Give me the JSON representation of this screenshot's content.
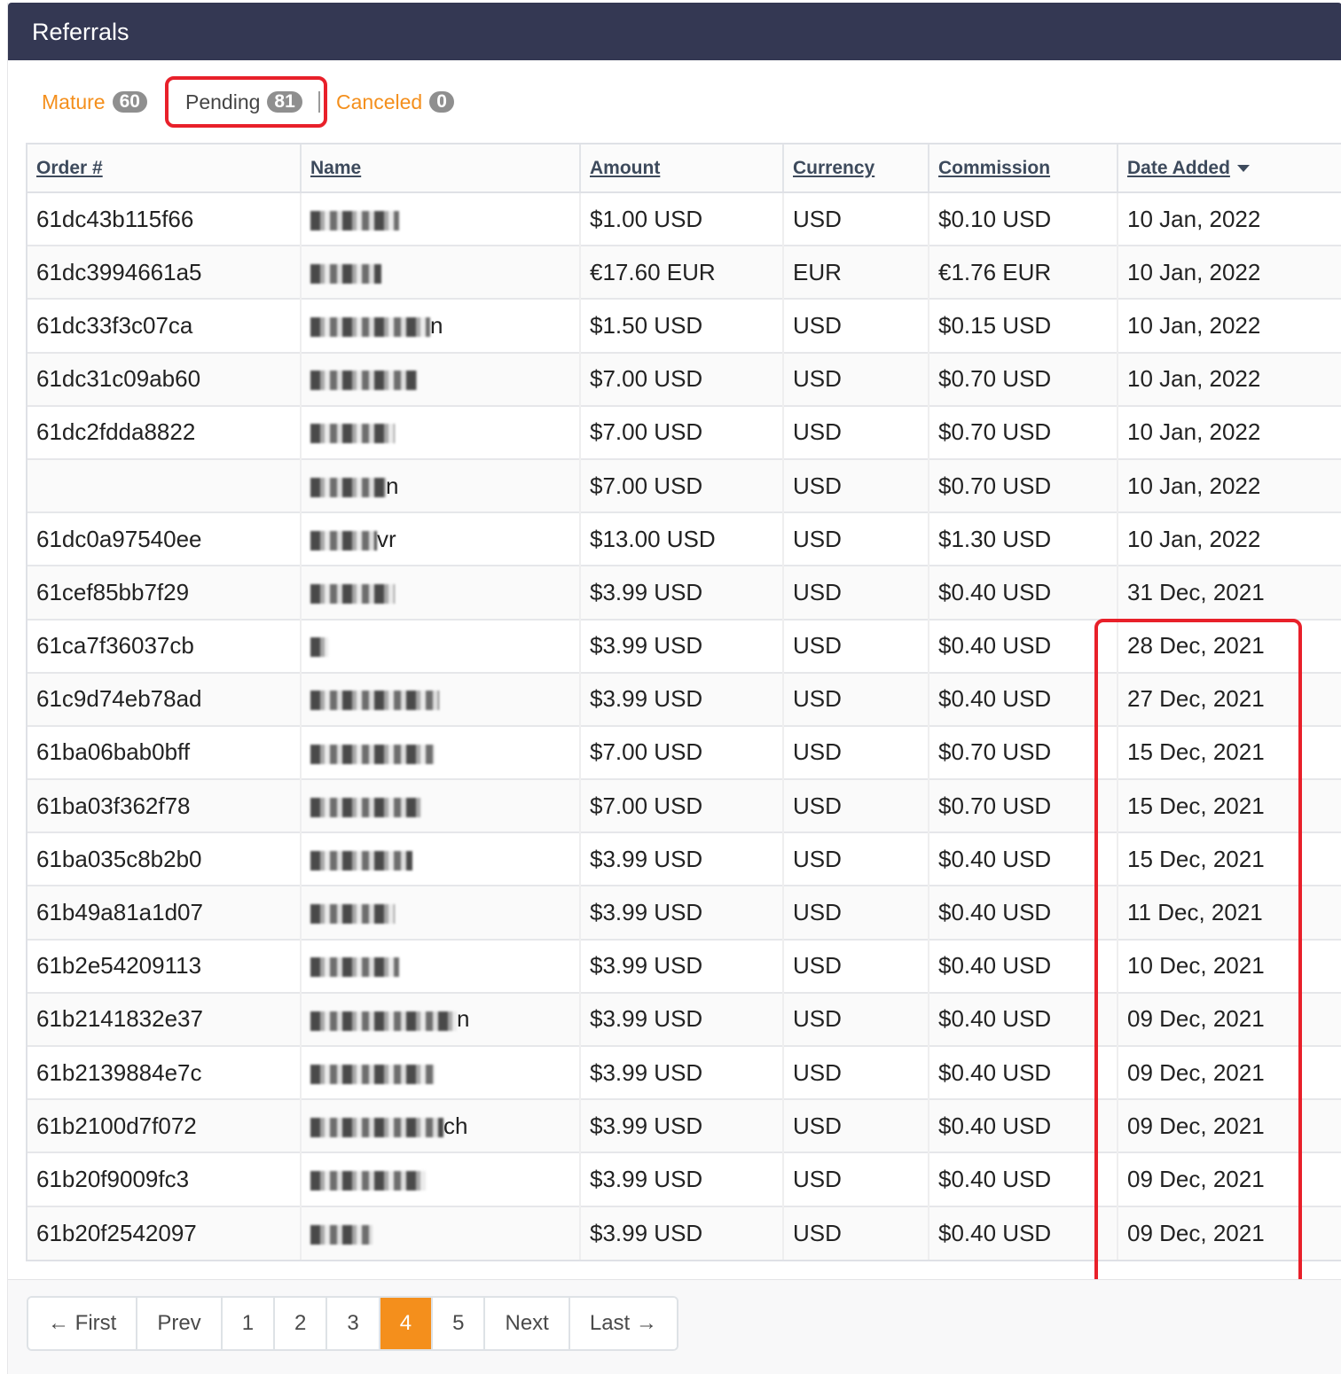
{
  "panel": {
    "title": "Referrals"
  },
  "tabs": [
    {
      "label": "Mature",
      "count": "60"
    },
    {
      "label": "Pending",
      "count": "81"
    },
    {
      "label": "Canceled",
      "count": "0"
    }
  ],
  "table": {
    "headers": [
      "Order #",
      "Name",
      "Amount",
      "Currency",
      "Commission",
      "Date Added"
    ],
    "rows": [
      {
        "order": "61dc43b115f66",
        "name_tail": "",
        "amount": "$1.00 USD",
        "currency": "USD",
        "commission": "$0.10 USD",
        "date": "10 Jan, 2022"
      },
      {
        "order": "61dc3994661a5",
        "name_tail": "",
        "amount": "€17.60 EUR",
        "currency": "EUR",
        "commission": "€1.76 EUR",
        "date": "10 Jan, 2022"
      },
      {
        "order": "61dc33f3c07ca",
        "name_tail": "n",
        "amount": "$1.50 USD",
        "currency": "USD",
        "commission": "$0.15 USD",
        "date": "10 Jan, 2022"
      },
      {
        "order": "61dc31c09ab60",
        "name_tail": "",
        "amount": "$7.00 USD",
        "currency": "USD",
        "commission": "$0.70 USD",
        "date": "10 Jan, 2022"
      },
      {
        "order": "61dc2fdda8822",
        "name_tail": "",
        "amount": "$7.00 USD",
        "currency": "USD",
        "commission": "$0.70 USD",
        "date": "10 Jan, 2022"
      },
      {
        "order": "",
        "name_tail": "n",
        "amount": "$7.00 USD",
        "currency": "USD",
        "commission": "$0.70 USD",
        "date": "10 Jan, 2022"
      },
      {
        "order": "61dc0a97540ee",
        "name_tail": "vr",
        "amount": "$13.00 USD",
        "currency": "USD",
        "commission": "$1.30 USD",
        "date": "10 Jan, 2022"
      },
      {
        "order": "61cef85bb7f29",
        "name_tail": "",
        "amount": "$3.99 USD",
        "currency": "USD",
        "commission": "$0.40 USD",
        "date": "31 Dec, 2021"
      },
      {
        "order": "61ca7f36037cb",
        "name_tail": "",
        "amount": "$3.99 USD",
        "currency": "USD",
        "commission": "$0.40 USD",
        "date": "28 Dec, 2021"
      },
      {
        "order": "61c9d74eb78ad",
        "name_tail": "",
        "amount": "$3.99 USD",
        "currency": "USD",
        "commission": "$0.40 USD",
        "date": "27 Dec, 2021"
      },
      {
        "order": "61ba06bab0bff",
        "name_tail": "",
        "amount": "$7.00 USD",
        "currency": "USD",
        "commission": "$0.70 USD",
        "date": "15 Dec, 2021"
      },
      {
        "order": "61ba03f362f78",
        "name_tail": "",
        "amount": "$7.00 USD",
        "currency": "USD",
        "commission": "$0.70 USD",
        "date": "15 Dec, 2021"
      },
      {
        "order": "61ba035c8b2b0",
        "name_tail": "",
        "amount": "$3.99 USD",
        "currency": "USD",
        "commission": "$0.40 USD",
        "date": "15 Dec, 2021"
      },
      {
        "order": "61b49a81a1d07",
        "name_tail": "",
        "amount": "$3.99 USD",
        "currency": "USD",
        "commission": "$0.40 USD",
        "date": "11 Dec, 2021"
      },
      {
        "order": "61b2e54209113",
        "name_tail": "",
        "amount": "$3.99 USD",
        "currency": "USD",
        "commission": "$0.40 USD",
        "date": "10 Dec, 2021"
      },
      {
        "order": "61b2141832e37",
        "name_tail": "n",
        "amount": "$3.99 USD",
        "currency": "USD",
        "commission": "$0.40 USD",
        "date": "09 Dec, 2021"
      },
      {
        "order": "61b2139884e7c",
        "name_tail": "",
        "amount": "$3.99 USD",
        "currency": "USD",
        "commission": "$0.40 USD",
        "date": "09 Dec, 2021"
      },
      {
        "order": "61b2100d7f072",
        "name_tail": "ch",
        "amount": "$3.99 USD",
        "currency": "USD",
        "commission": "$0.40 USD",
        "date": "09 Dec, 2021"
      },
      {
        "order": "61b20f9009fc3",
        "name_tail": "",
        "amount": "$3.99 USD",
        "currency": "USD",
        "commission": "$0.40 USD",
        "date": "09 Dec, 2021"
      },
      {
        "order": "61b20f2542097",
        "name_tail": "",
        "amount": "$3.99 USD",
        "currency": "USD",
        "commission": "$0.40 USD",
        "date": "09 Dec, 2021"
      }
    ]
  },
  "pagination": {
    "items": [
      {
        "label": "← First",
        "active": false
      },
      {
        "label": "Prev",
        "active": false
      },
      {
        "label": "1",
        "active": false
      },
      {
        "label": "2",
        "active": false
      },
      {
        "label": "3",
        "active": false
      },
      {
        "label": "4",
        "active": true
      },
      {
        "label": "5",
        "active": false
      },
      {
        "label": "Next",
        "active": false
      },
      {
        "label": "Last →",
        "active": false
      }
    ]
  },
  "colors": {
    "header_bg": "#343853",
    "accent": "#f48f1c",
    "highlight": "#e8202a"
  }
}
